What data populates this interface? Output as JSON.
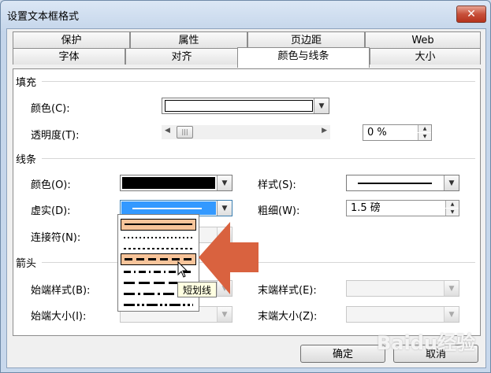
{
  "window": {
    "title": "设置文本框格式",
    "close_glyph": "✕"
  },
  "tabs_row1": [
    "保护",
    "属性",
    "页边距",
    "Web"
  ],
  "tabs_row2": [
    "字体",
    "对齐",
    "颜色与线条",
    "大小"
  ],
  "active_tab": "颜色与线条",
  "fill": {
    "section_label": "填充",
    "color_label": "颜色(C):",
    "color_value": "#ffffff",
    "transparency_label": "透明度(T):",
    "transparency_value": "0 %",
    "transparency_fraction": 0.0
  },
  "line": {
    "section_label": "线条",
    "color_label": "颜色(O):",
    "color_value": "#000000",
    "dash_label": "虚实(D):",
    "connector_label": "连接符(N):",
    "style_label": "样式(S):",
    "weight_label": "粗细(W):",
    "weight_value": "1.5 磅"
  },
  "arrows": {
    "section_label": "箭头",
    "begin_style_label": "始端样式(B):",
    "begin_size_label": "始端大小(I):",
    "end_style_label": "末端样式(E):",
    "end_size_label": "末端大小(Z):"
  },
  "dash_list": {
    "options": [
      "solid",
      "round-dot",
      "square-dot",
      "dash",
      "dash-dot",
      "long-dash",
      "long-dash-dot",
      "long-dash-dot-dot"
    ],
    "selected_index": 0,
    "hovered_index": 3,
    "tooltip": "短划线"
  },
  "buttons": {
    "ok": "确定",
    "cancel": "取消"
  },
  "watermark": "Baidu经验",
  "colors": {
    "highlight": "#f7c49a",
    "annotation_arrow": "#d9623f",
    "selected_blue": "#3399ff"
  }
}
